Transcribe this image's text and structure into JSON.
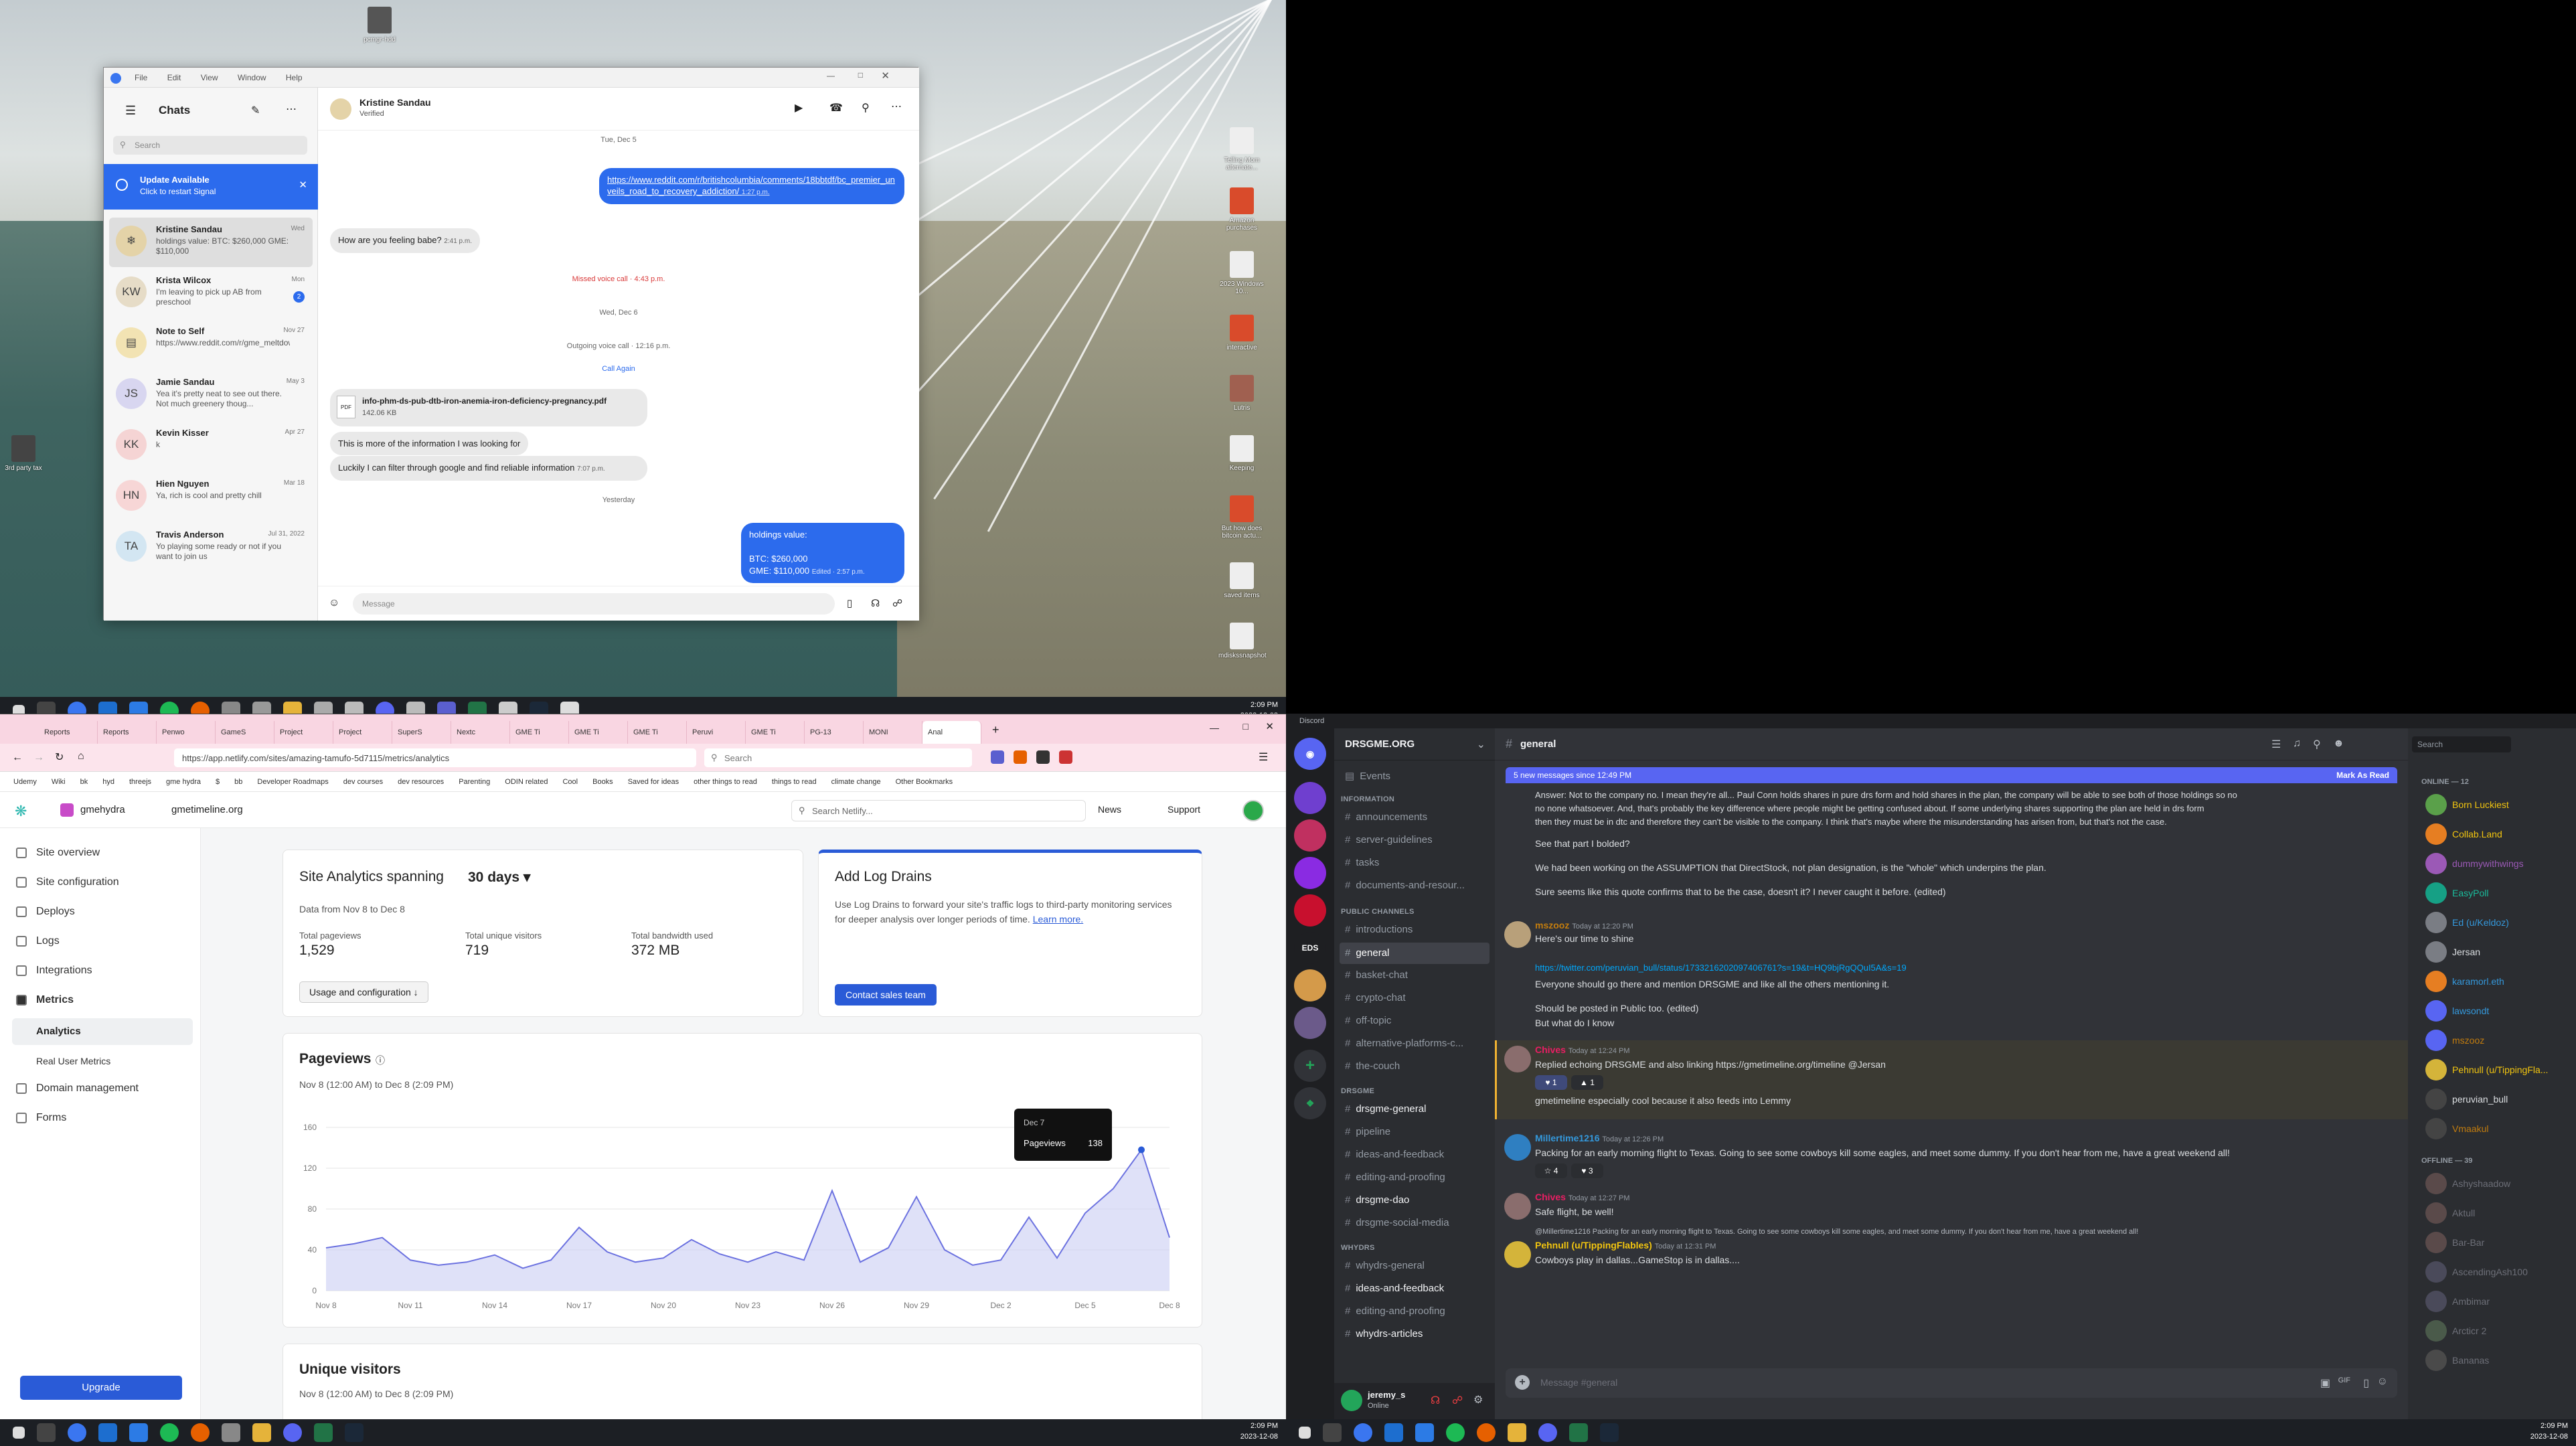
{
  "desktop": {
    "icons": [
      "pcmgr-hdd",
      "3rd party tax",
      "Telling Mom alternate...",
      "Amazon purchases",
      "2023 Windows 10...",
      "interactive",
      "Lutris",
      "Keeping",
      "ppt",
      "But how does bitcoin actu...",
      "saved items",
      "mdiskssnapshot"
    ]
  },
  "signal": {
    "menu": [
      "File",
      "Edit",
      "View",
      "Window",
      "Help"
    ],
    "header": "Chats",
    "search_placeholder": "Search",
    "update": {
      "title": "Update Available",
      "subtitle": "Click to restart Signal"
    },
    "chats": [
      {
        "name": "Kristine Sandau",
        "preview": "holdings value: BTC: $260,000 GME: $110,000",
        "date": "Wed",
        "initials": ""
      },
      {
        "name": "Krista Wilcox",
        "preview": "I'm leaving to pick up AB from preschool",
        "date": "Mon",
        "initials": "KW",
        "unread": "2"
      },
      {
        "name": "Note to Self",
        "preview": "https://www.reddit.com/r/gme_meltdown/comments/18s50...",
        "date": "Nov 27",
        "initials": ""
      },
      {
        "name": "Jamie Sandau",
        "preview": "Yea it's pretty neat to see out there. Not much greenery thoug...",
        "date": "May 3",
        "initials": "JS"
      },
      {
        "name": "Kevin Kisser",
        "preview": "k",
        "date": "Apr 27",
        "initials": "KK"
      },
      {
        "name": "Hien Nguyen",
        "preview": "Ya, rich is cool and pretty chill",
        "date": "Mar 18",
        "initials": "HN"
      },
      {
        "name": "Travis Anderson",
        "preview": "Yo playing some ready or not if you want to join us",
        "date": "Jul 31, 2022",
        "initials": "TA"
      }
    ],
    "contact": {
      "name": "Kristine Sandau",
      "verified": "Verified"
    },
    "messages": {
      "top_date": "Tue, Dec 5",
      "link": "https://www.reddit.com/r/britishcolumbia/comments/18bbtdf/bc_premier_unveils_road_to_recovery_addiction/",
      "link_time": "1:27 p.m.",
      "q": "How are you feeling babe?",
      "q_time": "2:41 p.m.",
      "missed": "Missed voice call · 4:43 p.m.",
      "date2": "Wed, Dec 6",
      "outgoing": "Outgoing voice call · 12:16 p.m.",
      "call_again": "Call Again",
      "file_name": "info-phm-ds-pub-dtb-iron-anemia-iron-deficiency-pregnancy.pdf",
      "file_size": "142.06 KB",
      "m1": "This is more of the information I was looking for",
      "m2": "Luckily I can filter through google and find reliable information",
      "m2_time": "7:07 p.m.",
      "date3": "Yesterday",
      "hv1": "holdings value:",
      "hv2": "BTC: $260,000",
      "hv3": "GME: $110,000",
      "hv_time": "Edited · 2:57 p.m."
    },
    "composer_placeholder": "Message"
  },
  "taskbar_top": {
    "time": "2:09 PM",
    "date": "2023-12-08"
  },
  "browser": {
    "tabs": [
      "Reports",
      "Reports",
      "Penwo",
      "GameS",
      "Project",
      "Project",
      "SuperS",
      "Nextc",
      "GME Ti",
      "GME Ti",
      "GME Ti",
      "Peruvi",
      "GME Ti",
      "PG-13",
      "MONI",
      "Anal"
    ],
    "url": "https://app.netlify.com/sites/amazing-tamufo-5d7115/metrics/analytics",
    "search_placeholder": "Search",
    "bookmarks": [
      "Udemy",
      "Wiki",
      "bk",
      "hyd",
      "threejs",
      "gme hydra",
      "$",
      "bb",
      "Developer Roadmaps",
      "dev courses",
      "dev resources",
      "Parenting",
      "ODIN related",
      "Cool",
      "Books",
      "Saved for ideas",
      "other things to read",
      "things to read",
      "climate change",
      "Other Bookmarks"
    ]
  },
  "netlify": {
    "team": "gmehydra",
    "site": "gmetimeline.org",
    "search": "Search Netlify...",
    "news": "News",
    "support": "Support",
    "nav": [
      "Site overview",
      "Site configuration",
      "Deploys",
      "Logs",
      "Integrations",
      "Metrics",
      "Analytics",
      "Real User Metrics",
      "Domain management",
      "Forms"
    ],
    "upgrade": "Upgrade",
    "analytics": {
      "title": "Site Analytics spanning",
      "span": "30 days",
      "range": "Data from Nov 8 to Dec 8",
      "stats": [
        {
          "label": "Total pageviews",
          "value": "1,529"
        },
        {
          "label": "Total unique visitors",
          "value": "719"
        },
        {
          "label": "Total bandwidth used",
          "value": "372 MB"
        }
      ],
      "usage_button": "Usage and configuration"
    },
    "logdrains": {
      "title": "Add Log Drains",
      "body": "Use Log Drains to forward your site's traffic logs to third-party monitoring services for deeper analysis over longer periods of time.",
      "link": "Learn more.",
      "button": "Contact sales team"
    },
    "pageviews": {
      "title": "Pageviews",
      "range": "Nov 8 (12:00 AM) to Dec 8 (2:09 PM)",
      "tooltip_date": "Dec 7",
      "tooltip_label": "Pageviews",
      "tooltip_value": "138"
    },
    "unique": {
      "title": "Unique visitors",
      "range": "Nov 8 (12:00 AM) to Dec 8 (2:09 PM)"
    }
  },
  "chart_data": {
    "type": "area",
    "title": "Pageviews",
    "x": [
      "Nov 8",
      "Nov 9",
      "Nov 10",
      "Nov 11",
      "Nov 12",
      "Nov 13",
      "Nov 14",
      "Nov 15",
      "Nov 16",
      "Nov 17",
      "Nov 18",
      "Nov 19",
      "Nov 20",
      "Nov 21",
      "Nov 22",
      "Nov 23",
      "Nov 24",
      "Nov 25",
      "Nov 26",
      "Nov 27",
      "Nov 28",
      "Nov 29",
      "Nov 30",
      "Dec 1",
      "Dec 2",
      "Dec 3",
      "Dec 4",
      "Dec 5",
      "Dec 6",
      "Dec 7",
      "Dec 8"
    ],
    "tick_labels": [
      "Nov 8",
      "Nov 11",
      "Nov 14",
      "Nov 17",
      "Nov 20",
      "Nov 23",
      "Nov 26",
      "Nov 29",
      "Dec 2",
      "Dec 5",
      "Dec 8"
    ],
    "values": [
      42,
      46,
      52,
      30,
      25,
      28,
      35,
      22,
      30,
      62,
      38,
      28,
      32,
      50,
      36,
      28,
      38,
      30,
      98,
      28,
      42,
      92,
      40,
      25,
      30,
      72,
      32,
      76,
      100,
      138,
      52
    ],
    "ylim": [
      0,
      160
    ],
    "yticks": [
      0,
      40,
      80,
      120,
      160
    ],
    "grid": true
  },
  "taskbar_bottom": {
    "time": "2:09 PM",
    "date": "2023-12-08"
  },
  "discord": {
    "app_title": "Discord",
    "server": "DRSGME.ORG",
    "channel": "general",
    "banner": "5 new messages since 12:49 PM",
    "mark_read": "Mark As Read",
    "search": "Search",
    "events": "Events",
    "categories": [
      {
        "name": "INFORMATION",
        "channels": [
          "announcements",
          "server-guidelines",
          "tasks",
          "documents-and-resour..."
        ]
      },
      {
        "name": "PUBLIC CHANNELS",
        "channels": [
          "introductions",
          "general",
          "basket-chat",
          "crypto-chat",
          "off-topic",
          "alternative-platforms-c...",
          "the-couch"
        ]
      },
      {
        "name": "DRSGME",
        "channels": [
          "drsgme-general",
          "pipeline",
          "ideas-and-feedback",
          "editing-and-proofing",
          "drsgme-dao",
          "drsgme-social-media"
        ]
      },
      {
        "name": "WHYDRS",
        "channels": [
          "whydrs-general",
          "ideas-and-feedback",
          "editing-and-proofing",
          "whydrs-articles"
        ]
      }
    ],
    "user": {
      "name": "jeremy_s",
      "status": "Online"
    },
    "messages": [
      {
        "text": "Answer: Not to the company no. I mean they're all... Paul Conn holds shares in pure drs form and hold shares in the plan, the company will be able to see both of those holdings so no"
      },
      {
        "text": "no none whatsoever. And, that's probably the key difference where people might be getting confused about. If some underlying shares supporting the plan are held in drs form"
      },
      {
        "text": "then they must be in dtc and therefore they can't be visible to the company. I think that's maybe where the misunderstanding has arisen from, but that's not the case."
      },
      {
        "text": "See that part I bolded?"
      },
      {
        "text": "We had been working on the ASSUMPTION that DirectStock, not plan designation, is the \"whole\" which underpins the plan."
      },
      {
        "text": "Sure seems like this quote confirms that to be the case, doesn't it? I never caught it before. (edited)"
      }
    ],
    "posts": [
      {
        "user": "mszooz",
        "time": "Today at 12:20 PM",
        "lines": [
          "Here's our time to shine",
          "https://twitter.com/peruvian_bull/status/1733216202097406761?s=19&t=HQ9bjRgQQuI5A&s=19",
          "Everyone should go there and mention DRSGME and like all the others mentioning it.",
          "Should be posted in Public too. (edited)",
          "But what do I know"
        ]
      },
      {
        "user": "Chives",
        "time": "Today at 12:24 PM",
        "lines": [
          "Replied echoing DRSGME and also linking https://gmetimeline.org/timeline @Jersan",
          "gmetimeline especially cool because it also feeds into Lemmy"
        ]
      },
      {
        "user": "Millertime1216",
        "time": "Today at 12:26 PM",
        "lines": [
          "Packing for an early morning flight to Texas. Going to see some cowboys kill some eagles, and meet some dummy.  If you don't hear from me, have a great weekend all!"
        ]
      },
      {
        "user": "Chives",
        "time": "Today at 12:27 PM",
        "lines": [
          "Safe flight, be well!"
        ]
      },
      {
        "user": "Pehnull (u/TippingFlables)",
        "time": "Today at 12:31 PM",
        "lines": [
          "Cowboys play in dallas...GameStop is in dallas...."
        ],
        "reply": "@Millertime1216 Packing for an early morning flight to Texas. Going to see some cowboys kill some eagles, and meet some dummy.  If you don't hear from me, have a great weekend all!"
      }
    ],
    "reactions": [
      "1",
      "1",
      "4",
      "3"
    ],
    "composer": "Message #general",
    "members_online_header": "ONLINE — 12",
    "members_online": [
      "Born Luckiest",
      "Collab.Land",
      "dummywithwings",
      "EasyPoll",
      "Ed (u/Keldoz)",
      "Jersan",
      "karamorl.eth",
      "lawsondt",
      "mszooz",
      "Pehnull (u/TippingFla...",
      "peruvian_bull",
      "Vmaakul"
    ],
    "members_offline_header": "OFFLINE — 39",
    "members_offline": [
      "Ashyshaadow",
      "Aktull",
      "Bar-Bar",
      "AscendingAsh100",
      "Ambimar",
      "Arcticr 2",
      "Bananas"
    ],
    "colors": {
      "blurple": "#5865f2",
      "green": "#23a55a"
    }
  }
}
